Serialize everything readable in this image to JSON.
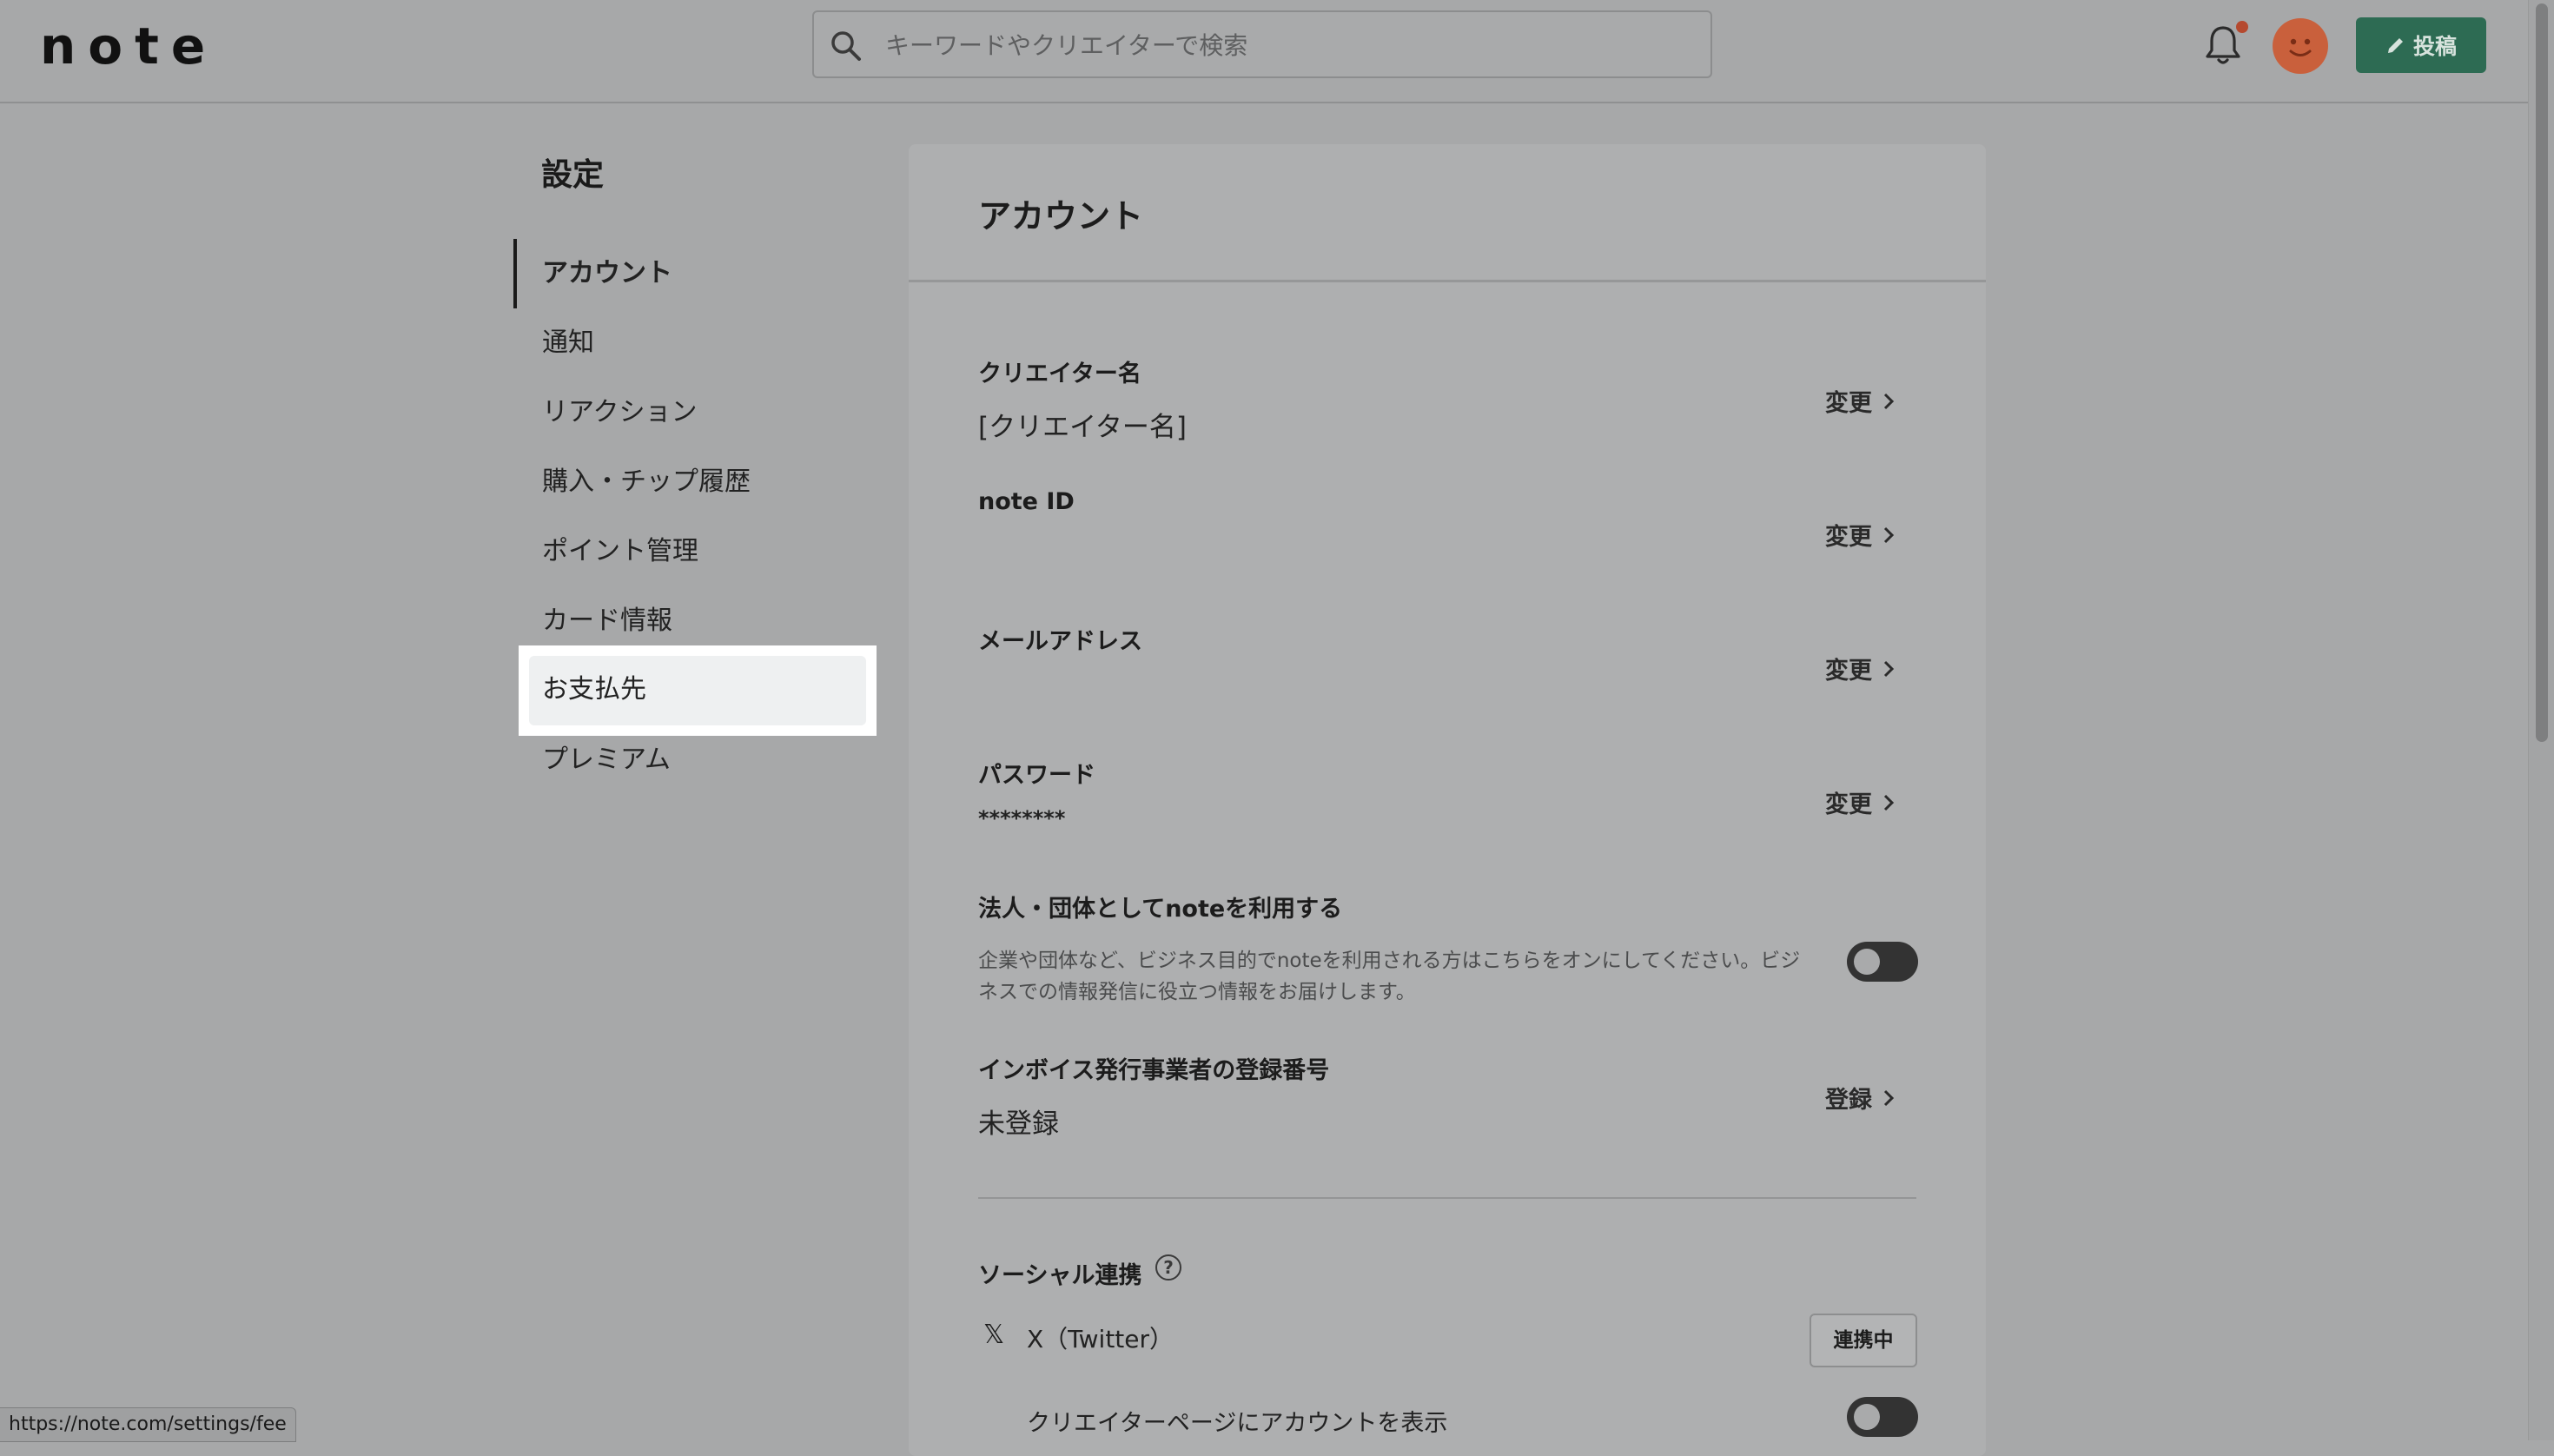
{
  "header": {
    "logo": "note",
    "search_placeholder": "キーワードやクリエイターで検索",
    "post_label": "投稿"
  },
  "sidebar": {
    "title": "設定",
    "items": [
      {
        "label": "アカウント",
        "active": true
      },
      {
        "label": "通知"
      },
      {
        "label": "リアクション"
      },
      {
        "label": "購入・チップ履歴"
      },
      {
        "label": "ポイント管理"
      },
      {
        "label": "カード情報"
      },
      {
        "label": "お支払先",
        "highlighted": true
      },
      {
        "label": "プレミアム"
      }
    ]
  },
  "main": {
    "title": "アカウント",
    "creator_name": {
      "label": "クリエイター名",
      "value": "[クリエイター名]",
      "action": "変更"
    },
    "note_id": {
      "label": "note ID",
      "action": "変更"
    },
    "email": {
      "label": "メールアドレス",
      "action": "変更"
    },
    "password": {
      "label": "パスワード",
      "value": "********",
      "action": "変更"
    },
    "corporate": {
      "label": "法人・団体としてnoteを利用する",
      "desc": "企業や団体など、ビジネス目的でnoteを利用される方はこちらをオンにしてください。ビジネスでの情報発信に役立つ情報をお届けします。",
      "enabled": false
    },
    "invoice": {
      "label": "インボイス発行事業者の登録番号",
      "value": "未登録",
      "action": "登録"
    },
    "social": {
      "label": "ソーシャル連携",
      "help": "?",
      "x_icon": "𝕏",
      "x_label": "X（Twitter）",
      "x_status": "連携中",
      "show_label": "クリエイターページにアカウントを表示",
      "show_enabled": false
    }
  },
  "status_bar": {
    "url": "https://note.com/settings/fee"
  },
  "colors": {
    "accent": "#2d6b53",
    "avatar": "#c9603c",
    "notification": "#b5492f"
  }
}
